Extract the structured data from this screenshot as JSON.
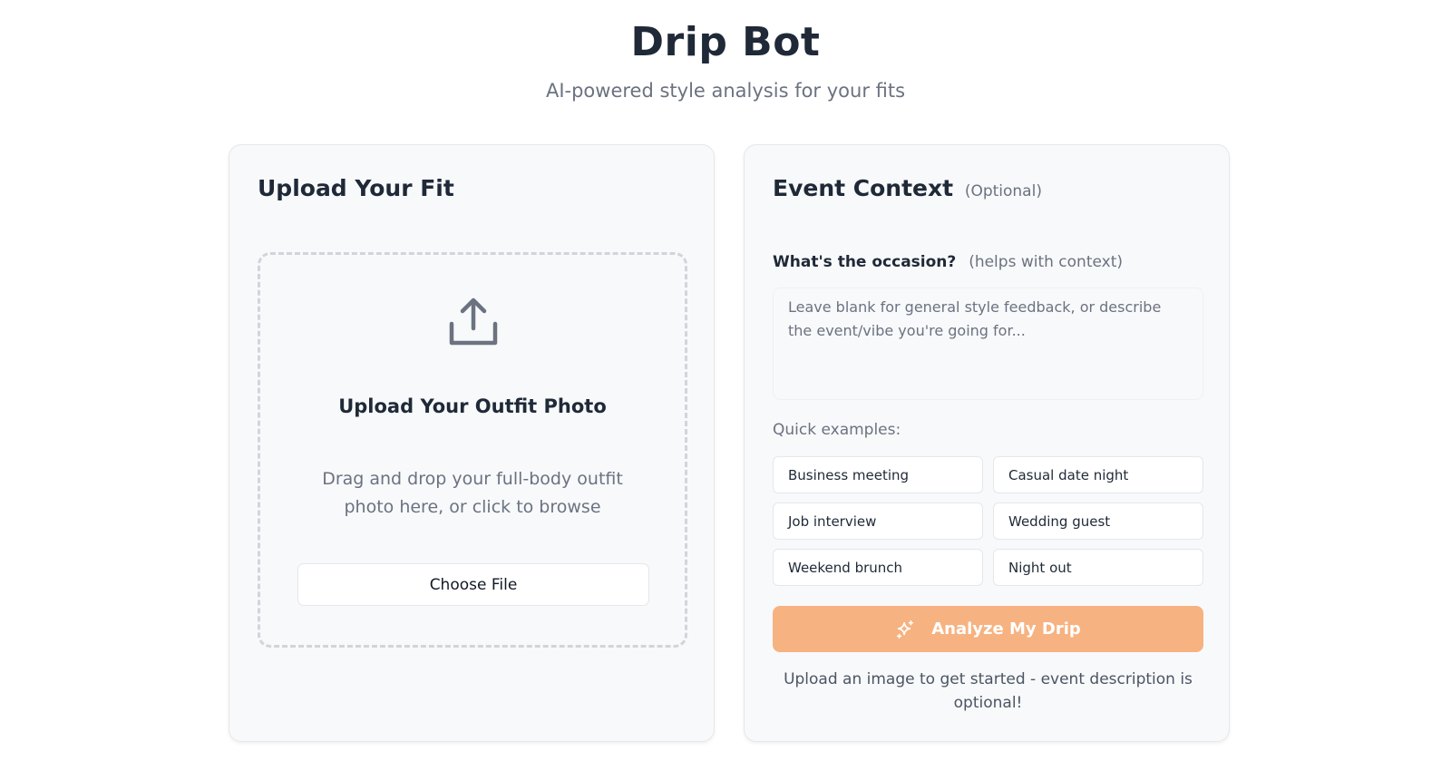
{
  "app": {
    "title": "Drip Bot",
    "subtitle": "AI-powered style analysis for your fits"
  },
  "upload_card": {
    "heading": "Upload Your Fit",
    "dropzone": {
      "icon": "upload-icon",
      "title": "Upload Your Outfit Photo",
      "description": "Drag and drop your full-body outfit photo here, or click to browse",
      "button_label": "Choose File"
    }
  },
  "event_card": {
    "heading": "Event Context",
    "heading_optional": "(Optional)",
    "occasion_label": "What's the occasion?",
    "occasion_hint": "(helps with context)",
    "occasion_value": "",
    "occasion_placeholder": "Leave blank for general style feedback, or describe the event/vibe you're going for...",
    "quick_examples_label": "Quick examples:",
    "quick_examples": [
      "Business meeting",
      "Casual date night",
      "Job interview",
      "Wedding guest",
      "Weekend brunch",
      "Night out"
    ],
    "analyze_button": {
      "label": "Analyze My Drip",
      "icon": "sparkle-icon",
      "color": "#f7b281"
    },
    "footer_note": "Upload an image to get started - event description is optional!"
  },
  "colors": {
    "accent": "#f7b281",
    "text_primary": "#1f2937",
    "text_muted": "#6b7280",
    "card_bg": "#f8f9fb"
  }
}
